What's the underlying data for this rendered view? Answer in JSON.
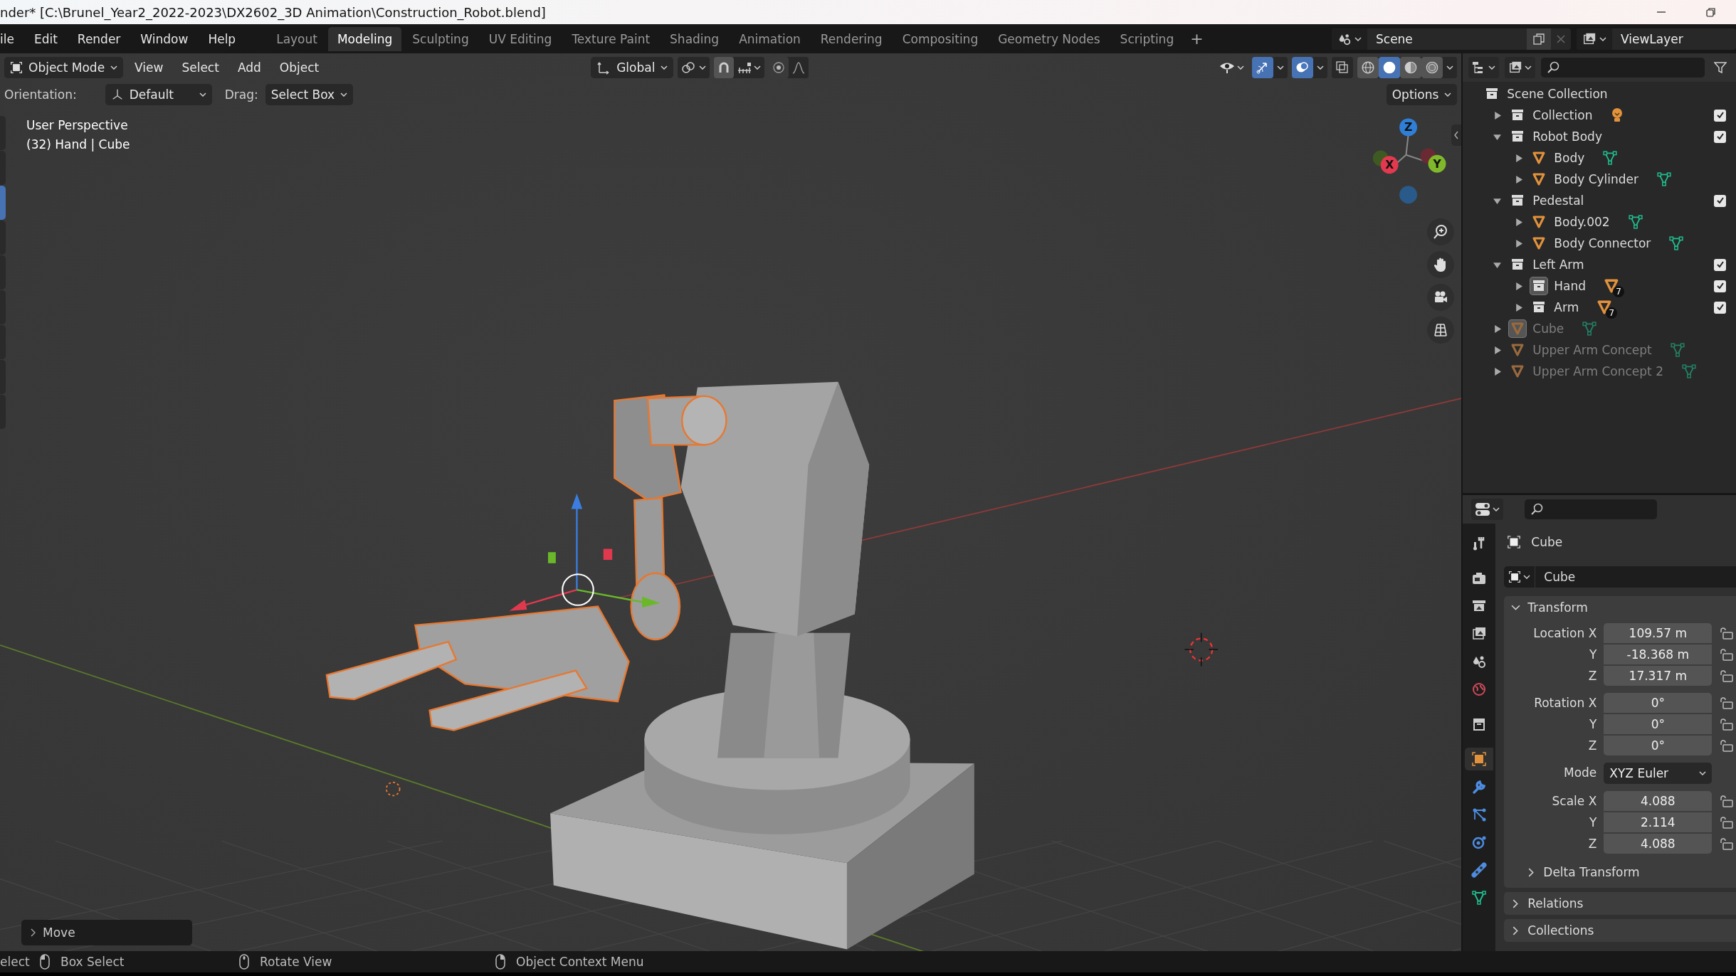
{
  "title_bar": {
    "title": "nder* [C:\\Brunel_Year2_2022-2023\\DX2602_3D Animation\\Construction_Robot.blend]"
  },
  "menu": [
    "ile",
    "Edit",
    "Render",
    "Window",
    "Help"
  ],
  "workspace_tabs": [
    {
      "label": "Layout",
      "selected": false
    },
    {
      "label": "Modeling",
      "selected": true
    },
    {
      "label": "Sculpting",
      "selected": false
    },
    {
      "label": "UV Editing",
      "selected": false
    },
    {
      "label": "Texture Paint",
      "selected": false
    },
    {
      "label": "Shading",
      "selected": false
    },
    {
      "label": "Animation",
      "selected": false
    },
    {
      "label": "Rendering",
      "selected": false
    },
    {
      "label": "Compositing",
      "selected": false
    },
    {
      "label": "Geometry Nodes",
      "selected": false
    },
    {
      "label": "Scripting",
      "selected": false
    }
  ],
  "add_tab": "+",
  "scene": {
    "name": "Scene"
  },
  "view_layer": {
    "name": "ViewLayer"
  },
  "viewport_header": {
    "mode": "Object Mode",
    "menus": [
      "View",
      "Select",
      "Add",
      "Object"
    ],
    "orientation": "Global",
    "toggles": [
      {
        "kind": "gizmo",
        "on": true
      },
      {
        "kind": "overlay",
        "on": true
      },
      {
        "kind": "xray",
        "on": false
      }
    ],
    "shading": [
      {
        "kind": "wireframe",
        "selected": false
      },
      {
        "kind": "solid",
        "selected": true
      },
      {
        "kind": "material",
        "selected": false
      },
      {
        "kind": "rendered",
        "selected": false
      }
    ]
  },
  "tool_settings": {
    "orientation_label": "Orientation:",
    "orientation": "Default",
    "drag_label": "Drag:",
    "drag": "Select Box",
    "options": "Options"
  },
  "toolbar": [
    {
      "selected": false
    },
    {
      "selected": false
    },
    {
      "selected": true
    },
    {
      "selected": false
    },
    {
      "selected": false
    },
    {
      "selected": false
    },
    {
      "selected": false
    },
    {
      "selected": false
    },
    {
      "selected": false
    }
  ],
  "viewport": {
    "lines": [
      "User Perspective",
      "(32) Hand | Cube"
    ]
  },
  "nav_gizmo": {
    "axes": [
      {
        "label": "Z",
        "color": "#2f7fd8"
      },
      {
        "label": "Y",
        "color": "#7fb82a"
      },
      {
        "label": "X",
        "color": "#e2394e"
      }
    ]
  },
  "last_operator": {
    "label": "Move",
    "expanded": false
  },
  "outliner": {
    "root": "Scene Collection",
    "items": [
      {
        "name": "Collection",
        "kind": "collection",
        "expanded": false,
        "checked": true,
        "active": false,
        "dimmed": false,
        "extra": {
          "kind": "light"
        }
      },
      {
        "name": "Robot Body",
        "kind": "collection",
        "expanded": true,
        "checked": true,
        "active": false,
        "dimmed": false,
        "children": [
          {
            "name": "Body",
            "kind": "mesh",
            "expanded": false,
            "checked": false,
            "active": false,
            "dimmed": false,
            "extra": {
              "kind": "mesh_data"
            }
          },
          {
            "name": "Body Cylinder",
            "kind": "mesh",
            "expanded": false,
            "checked": false,
            "active": false,
            "dimmed": false,
            "extra": {
              "kind": "mesh_data"
            }
          }
        ]
      },
      {
        "name": "Pedestal",
        "kind": "collection",
        "expanded": true,
        "checked": true,
        "active": false,
        "dimmed": false,
        "children": [
          {
            "name": "Body.002",
            "kind": "mesh",
            "expanded": false,
            "checked": false,
            "active": false,
            "dimmed": false,
            "extra": {
              "kind": "mesh_data"
            }
          },
          {
            "name": "Body Connector",
            "kind": "mesh",
            "expanded": false,
            "checked": false,
            "active": false,
            "dimmed": false,
            "extra": {
              "kind": "mesh_data"
            }
          }
        ]
      },
      {
        "name": "Left Arm",
        "kind": "collection",
        "expanded": true,
        "checked": true,
        "active": false,
        "dimmed": false,
        "children": [
          {
            "name": "Hand",
            "kind": "collection",
            "expanded": false,
            "checked": true,
            "active": true,
            "dimmed": false,
            "extra": {
              "kind": "mesh_objects",
              "badge": "7"
            }
          },
          {
            "name": "Arm",
            "kind": "collection",
            "expanded": false,
            "checked": true,
            "active": false,
            "dimmed": false,
            "extra": {
              "kind": "mesh_objects",
              "badge": "7"
            }
          }
        ]
      },
      {
        "name": "Cube",
        "kind": "mesh",
        "expanded": false,
        "checked": false,
        "active": true,
        "dimmed": true,
        "extra": {
          "kind": "mesh_data"
        }
      },
      {
        "name": "Upper Arm Concept",
        "kind": "mesh",
        "expanded": false,
        "checked": false,
        "active": false,
        "dimmed": true,
        "extra": {
          "kind": "mesh_data"
        }
      },
      {
        "name": "Upper Arm Concept 2",
        "kind": "mesh",
        "expanded": false,
        "checked": false,
        "active": false,
        "dimmed": true,
        "extra": {
          "kind": "mesh_data"
        }
      }
    ]
  },
  "properties": {
    "tabs": [
      {
        "kind": "tool",
        "selected": false
      },
      {
        "kind": "render",
        "selected": false
      },
      {
        "kind": "output",
        "selected": false
      },
      {
        "kind": "view_layer",
        "selected": false
      },
      {
        "kind": "scene",
        "selected": false
      },
      {
        "kind": "world",
        "selected": false
      },
      {
        "kind": "collection",
        "selected": false
      },
      {
        "kind": "object",
        "selected": true
      },
      {
        "kind": "modifiers",
        "selected": false
      },
      {
        "kind": "particles",
        "selected": false
      },
      {
        "kind": "physics",
        "selected": false
      },
      {
        "kind": "constraints",
        "selected": false
      },
      {
        "kind": "data",
        "selected": false
      }
    ],
    "object_name": "Cube",
    "datablock": "Cube",
    "panels": [
      {
        "title": "Transform",
        "expanded": true,
        "groups": [
          {
            "rows": [
              {
                "label": "Location X",
                "value": "109.57 m"
              },
              {
                "label": "Y",
                "value": "-18.368 m"
              },
              {
                "label": "Z",
                "value": "17.317 m"
              }
            ]
          },
          {
            "rows": [
              {
                "label": "Rotation X",
                "value": "0°"
              },
              {
                "label": "Y",
                "value": "0°"
              },
              {
                "label": "Z",
                "value": "0°"
              }
            ]
          },
          {
            "kind": "dropdown",
            "rows": [
              {
                "label": "Mode",
                "value": "XYZ Euler"
              }
            ]
          },
          {
            "rows": [
              {
                "label": "Scale X",
                "value": "4.088"
              },
              {
                "label": "Y",
                "value": "2.114"
              },
              {
                "label": "Z",
                "value": "4.088"
              }
            ]
          }
        ],
        "children": [
          {
            "title": "Delta Transform",
            "expanded": false
          }
        ]
      },
      {
        "title": "Relations",
        "expanded": false
      },
      {
        "title": "Collections",
        "expanded": false
      }
    ]
  },
  "status_bar": [
    {
      "label": "elect"
    },
    {
      "mouse": {
        "kind": "left"
      },
      "label": "Box Select"
    },
    {
      "mouse": {
        "kind": "middle"
      },
      "label": "Rotate View"
    },
    {
      "mouse": {
        "kind": "right"
      },
      "label": "Object Context Menu"
    }
  ]
}
